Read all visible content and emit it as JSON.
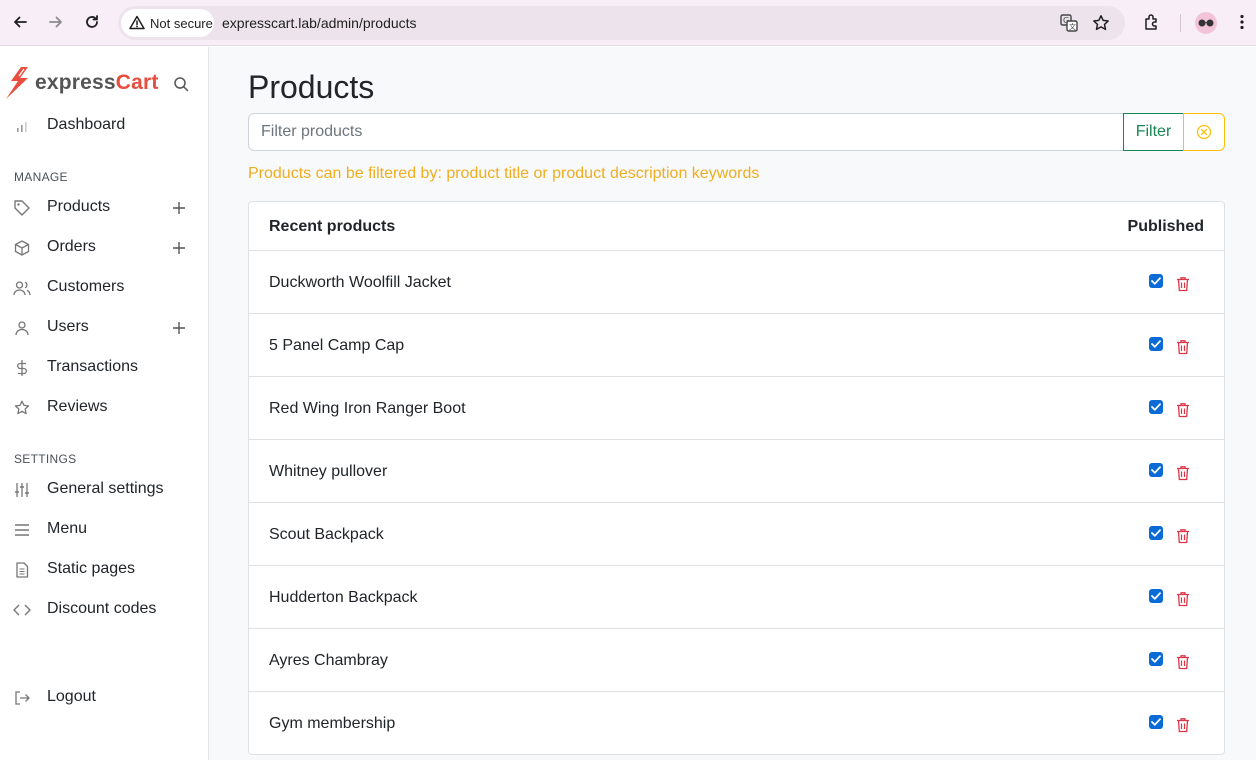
{
  "browser": {
    "security_label": "Not secure",
    "url": "expresscart.lab/admin/products"
  },
  "sidebar": {
    "brand_part1": "express",
    "brand_part2": "Cart",
    "dashboard": "Dashboard",
    "manage_label": "MANAGE",
    "manage_items": [
      {
        "label": "Products",
        "icon": "tag-icon",
        "has_add": true
      },
      {
        "label": "Orders",
        "icon": "box-icon",
        "has_add": true
      },
      {
        "label": "Customers",
        "icon": "users-icon",
        "has_add": false
      },
      {
        "label": "Users",
        "icon": "user-icon",
        "has_add": true
      },
      {
        "label": "Transactions",
        "icon": "dollar-icon",
        "has_add": false
      },
      {
        "label": "Reviews",
        "icon": "star-icon",
        "has_add": false
      }
    ],
    "settings_label": "SETTINGS",
    "settings_items": [
      {
        "label": "General settings",
        "icon": "sliders-icon"
      },
      {
        "label": "Menu",
        "icon": "menu-icon"
      },
      {
        "label": "Static pages",
        "icon": "file-icon"
      },
      {
        "label": "Discount codes",
        "icon": "code-icon"
      }
    ],
    "logout": "Logout"
  },
  "main": {
    "title": "Products",
    "filter_placeholder": "Filter products",
    "filter_button": "Filter",
    "hint": "Products can be filtered by: product title or product description keywords",
    "table": {
      "heading": "Recent products",
      "published_heading": "Published",
      "rows": [
        {
          "name": "Duckworth Woolfill Jacket",
          "published": true
        },
        {
          "name": "5 Panel Camp Cap",
          "published": true
        },
        {
          "name": "Red Wing Iron Ranger Boot",
          "published": true
        },
        {
          "name": "Whitney pullover",
          "published": true
        },
        {
          "name": "Scout Backpack",
          "published": true
        },
        {
          "name": "Hudderton Backpack",
          "published": true
        },
        {
          "name": "Ayres Chambray",
          "published": true
        },
        {
          "name": "Gym membership",
          "published": true
        }
      ]
    }
  },
  "colors": {
    "brand_red": "#e84d3d",
    "filter_green": "#198754",
    "hint_amber": "#f0ad1e",
    "delete_red": "#dc3545",
    "check_blue": "#0b6bd6"
  }
}
